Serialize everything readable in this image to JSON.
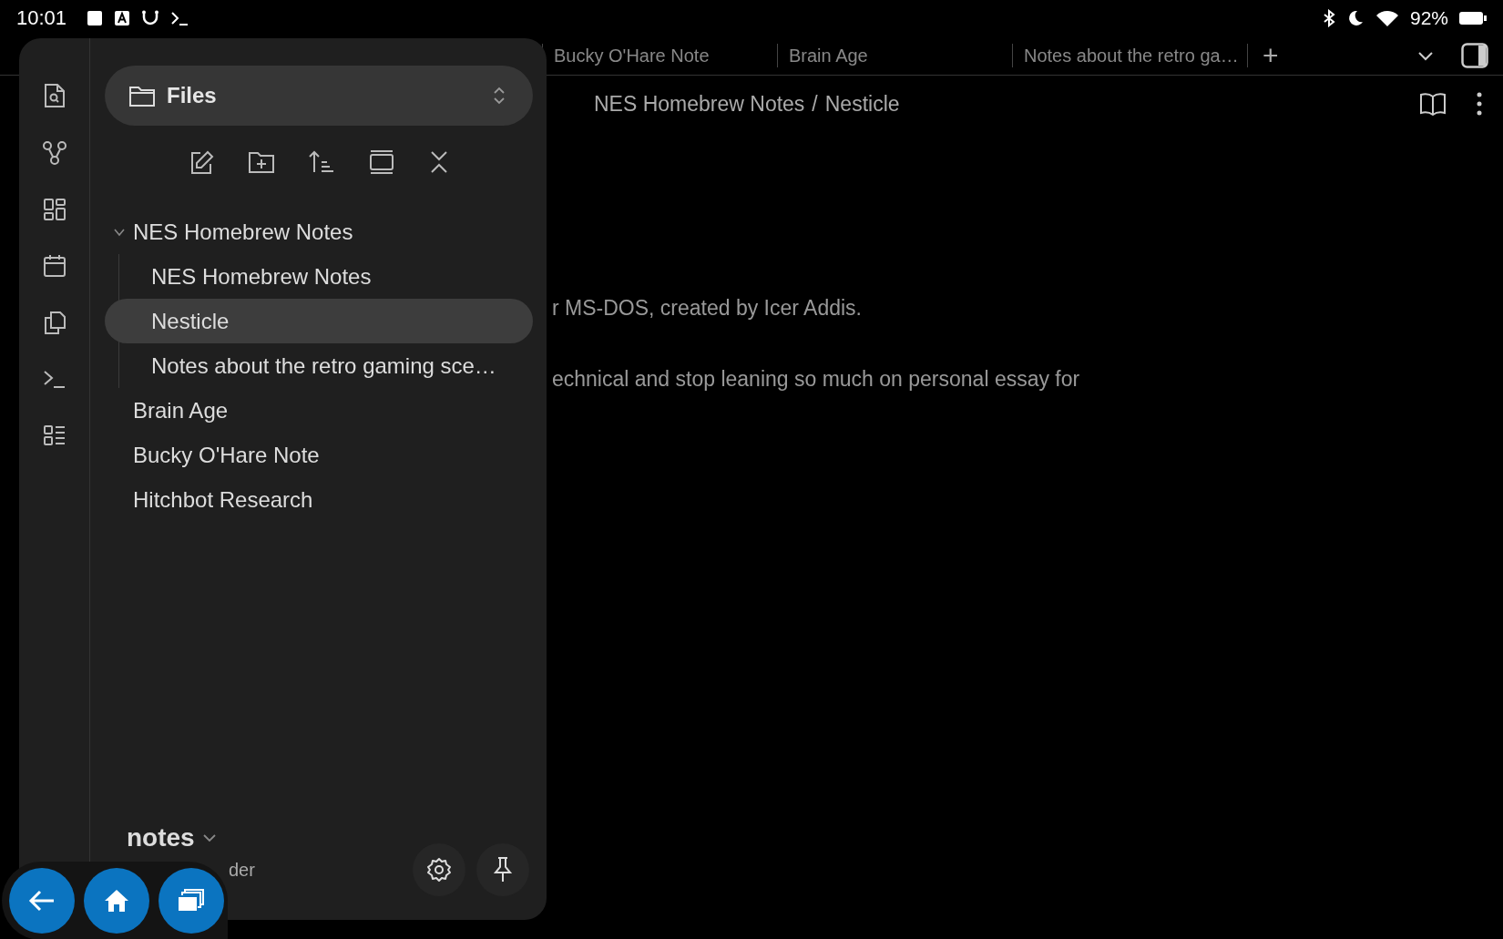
{
  "status_bar": {
    "time": "10:01",
    "battery": "92%"
  },
  "tabs": [
    {
      "label": "Bucky O'Hare Note"
    },
    {
      "label": "Brain Age"
    },
    {
      "label": "Notes about the retro ga…"
    }
  ],
  "new_tab": "+",
  "breadcrumb": [
    "NES Homebrew Notes",
    "/",
    "Nesticle"
  ],
  "content": [
    "r MS-DOS, created by Icer Addis.",
    "echnical and stop leaning so much on personal essay for"
  ],
  "drawer": {
    "title": "Files",
    "tree": [
      {
        "label": "NES Homebrew Notes",
        "kind": "folder",
        "expanded": true,
        "children": [
          {
            "label": "NES Homebrew Notes",
            "selected": false
          },
          {
            "label": "Nesticle",
            "selected": true
          },
          {
            "label": "Notes about the retro gaming sce…",
            "selected": false
          }
        ]
      },
      {
        "label": "Brain Age",
        "kind": "file",
        "selected": false
      },
      {
        "label": "Bucky O'Hare Note",
        "kind": "file",
        "selected": false
      },
      {
        "label": "Hitchbot Research",
        "kind": "file",
        "selected": false
      }
    ],
    "vault": "notes",
    "vault_subtitle": "der"
  }
}
